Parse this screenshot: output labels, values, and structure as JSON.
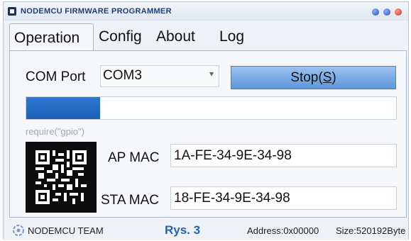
{
  "window": {
    "title": "NODEMCU FIRMWARE PROGRAMMER",
    "controls": [
      "minimize-dot",
      "maximize-dot",
      "close-dot"
    ]
  },
  "tabs": [
    {
      "label": "Operation",
      "active": true
    },
    {
      "label": "Config",
      "active": false
    },
    {
      "label": "About",
      "active": false
    },
    {
      "label": "Log",
      "active": false
    }
  ],
  "operation": {
    "com_port_label": "COM Port",
    "com_port_value": "COM3",
    "stop_button": {
      "label": "Stop(",
      "accel": "S",
      "suffix": ")"
    },
    "progress": 0.2,
    "require_text": "require(\"gpio\")",
    "ap_mac_label": "AP MAC",
    "ap_mac_value": "1A-FE-34-9E-34-98",
    "sta_mac_label": "STA MAC",
    "sta_mac_value": "18-FE-34-9E-34-98"
  },
  "statusbar": {
    "team": "NODEMCU TEAM",
    "caption": "Rys. 3",
    "address": "Address:0x00000",
    "size": "Size:520192Byte"
  },
  "colors": {
    "accent": "#5e96da",
    "progress": "#2b78d6",
    "title_text": "#1d3d7a",
    "caption_text": "#1f64b8"
  },
  "icons": {
    "app": "app-icon",
    "dropdown": "chevron-down-icon",
    "qr": "qr-code-icon",
    "team": "nodemcu-team-icon"
  }
}
